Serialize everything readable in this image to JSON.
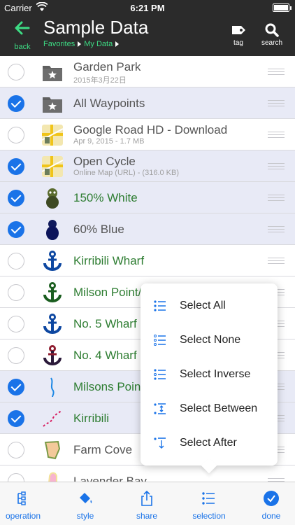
{
  "status": {
    "carrier": "Carrier",
    "time": "6:21 PM"
  },
  "nav": {
    "back_label": "back",
    "title": "Sample Data",
    "breadcrumb": [
      "Favorites",
      "My Data"
    ],
    "tag_label": "tag",
    "search_label": "search"
  },
  "rows": [
    {
      "title": "Garden Park",
      "subtitle": "2015年3月22日",
      "selected": false,
      "icon": "folder-star-icon"
    },
    {
      "title": "All Waypoints",
      "subtitle": "",
      "selected": true,
      "icon": "folder-star-icon"
    },
    {
      "title": "Google Road HD - Download",
      "subtitle": "Apr 9, 2015 - 1.7 MB",
      "selected": false,
      "icon": "map-tile-icon"
    },
    {
      "title": "Open Cycle",
      "subtitle": "Online Map (URL) - (316.0 KB)",
      "selected": true,
      "icon": "map-tile-icon"
    },
    {
      "title": "150% White",
      "subtitle": "",
      "selected": true,
      "icon": "character-icon"
    },
    {
      "title": "60% Blue",
      "subtitle": "",
      "selected": true,
      "icon": "character-blue-icon"
    },
    {
      "title": "Kirribili Wharf",
      "subtitle": "",
      "selected": false,
      "icon": "anchor-icon"
    },
    {
      "title": "Milson Point/",
      "subtitle": "",
      "selected": false,
      "icon": "anchor-green-icon"
    },
    {
      "title": "No. 5 Wharf",
      "subtitle": "",
      "selected": false,
      "icon": "anchor-icon"
    },
    {
      "title": "No. 4 Wharf",
      "subtitle": "",
      "selected": false,
      "icon": "anchor-red-icon"
    },
    {
      "title": "Milsons Point",
      "subtitle": "",
      "selected": true,
      "icon": "track-line-icon"
    },
    {
      "title": "Kirribili",
      "subtitle": "",
      "selected": true,
      "icon": "track-dotted-icon"
    },
    {
      "title": "Farm Cove",
      "subtitle": "",
      "selected": false,
      "icon": "area-shape-icon"
    },
    {
      "title": "Lavender Bay",
      "subtitle": "",
      "selected": false,
      "icon": "area-pink-icon"
    }
  ],
  "popover": {
    "items": [
      "Select All",
      "Select None",
      "Select Inverse",
      "Select Between",
      "Select After"
    ]
  },
  "tabs": [
    "operation",
    "style",
    "share",
    "selection",
    "done"
  ],
  "colors": {
    "accent": "#1a73e8",
    "green": "#3ddc84",
    "bar": "#2b2b2b",
    "selected_row": "#e8eaf6"
  }
}
